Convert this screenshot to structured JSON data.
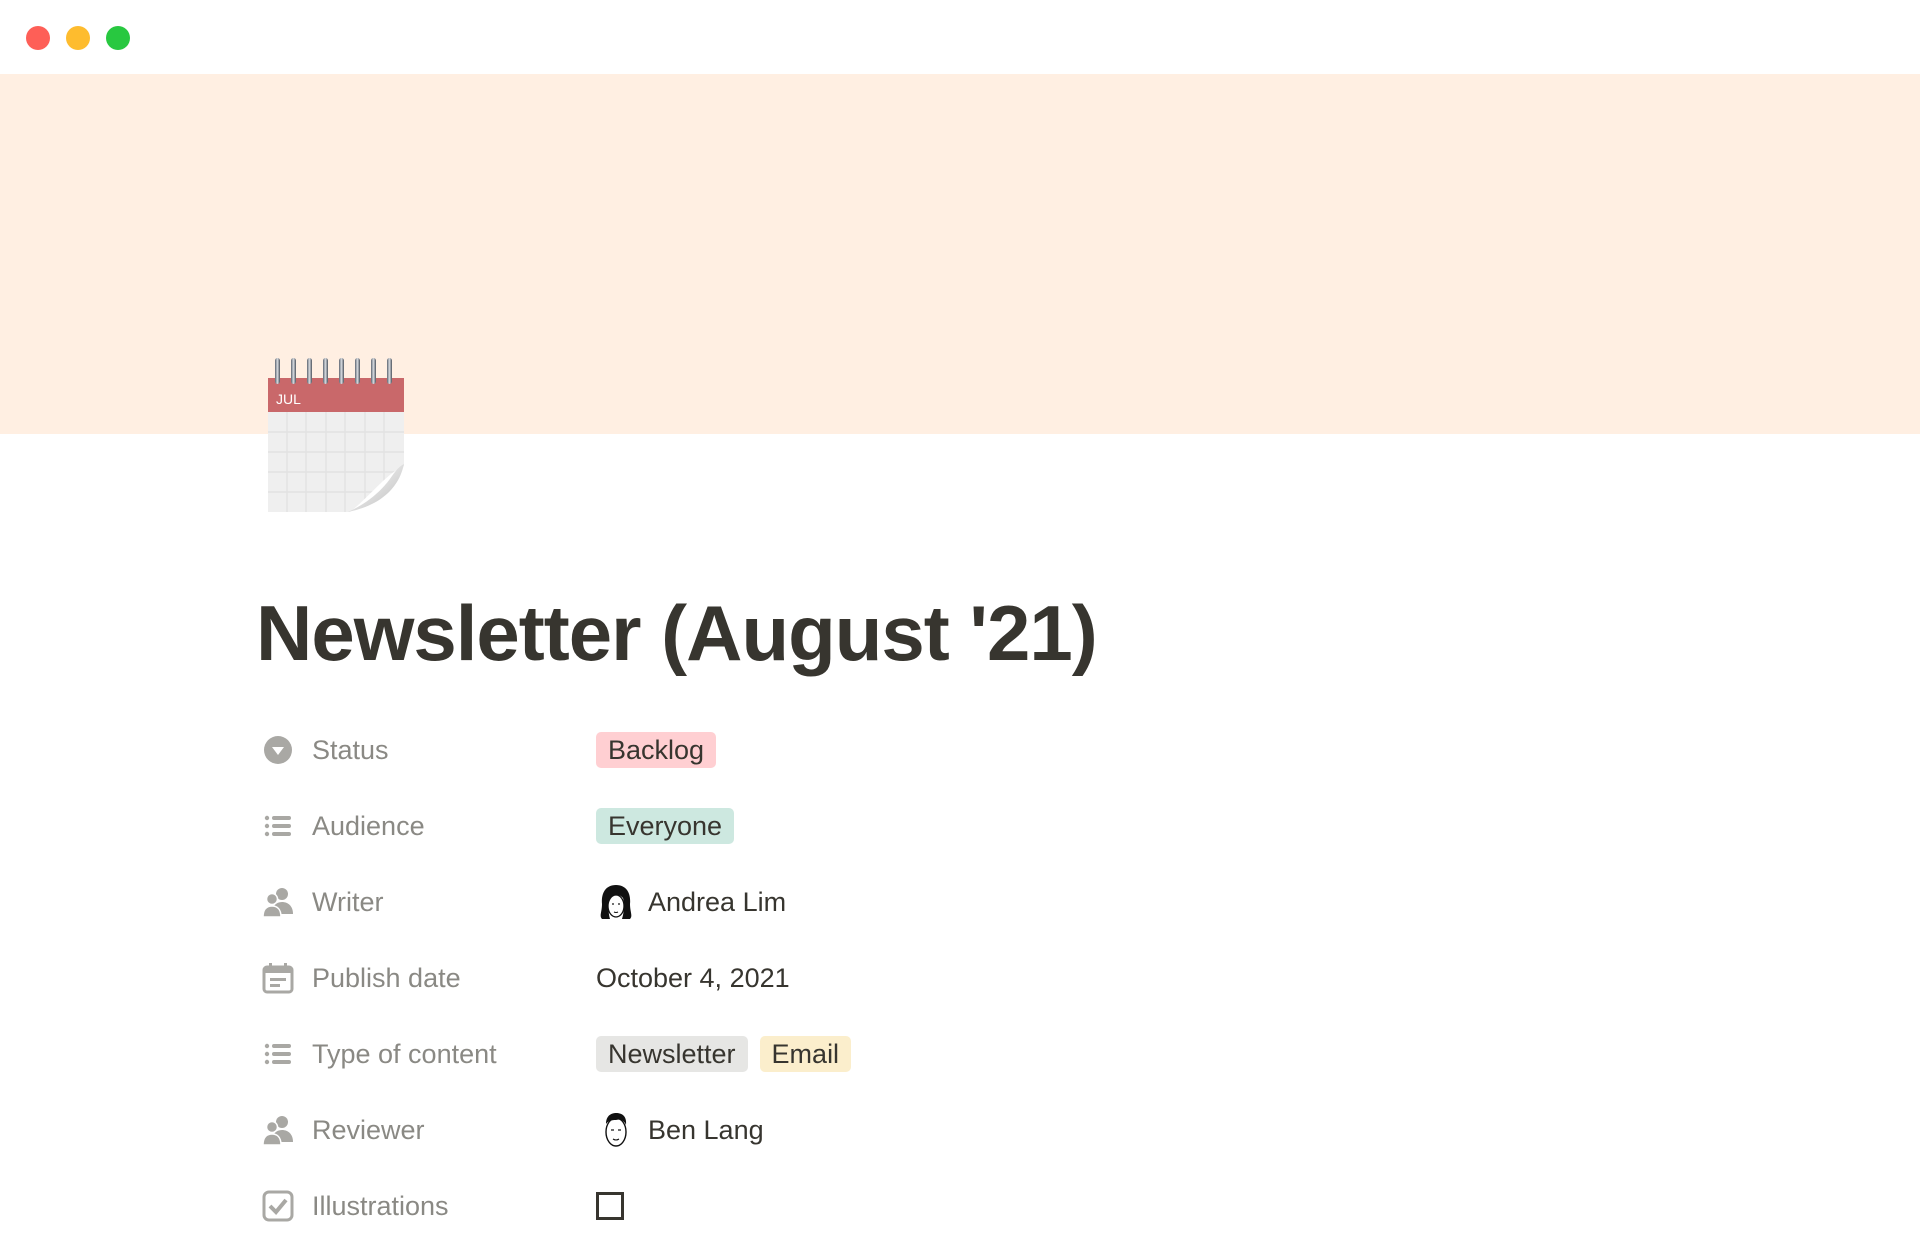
{
  "window": {
    "controls": [
      "close",
      "minimize",
      "maximize"
    ],
    "colors": {
      "close": "#fe5f57",
      "minimize": "#febc2e",
      "maximize": "#28c840"
    }
  },
  "cover": {
    "color": "#ffefe2"
  },
  "page": {
    "icon": "calendar-icon",
    "icon_month": "JUL",
    "title": "Newsletter (August '21)"
  },
  "properties": [
    {
      "label": "Status",
      "icon": "status-select-icon",
      "type": "select",
      "tags": [
        {
          "text": "Backlog",
          "color": "#ffcfd2"
        }
      ]
    },
    {
      "label": "Audience",
      "icon": "list-icon",
      "type": "multi_select",
      "tags": [
        {
          "text": "Everyone",
          "color": "#cde8e0"
        }
      ]
    },
    {
      "label": "Writer",
      "icon": "person-icon",
      "type": "person",
      "person": {
        "name": "Andrea Lim",
        "avatar": "avatar-andrea-lim"
      }
    },
    {
      "label": "Publish date",
      "icon": "calendar-date-icon",
      "type": "date",
      "value": "October 4, 2021"
    },
    {
      "label": "Type of content",
      "icon": "list-icon",
      "type": "multi_select",
      "tags": [
        {
          "text": "Newsletter",
          "color": "#e6e6e4"
        },
        {
          "text": "Email",
          "color": "#fbeecc"
        }
      ]
    },
    {
      "label": "Reviewer",
      "icon": "person-icon",
      "type": "person",
      "person": {
        "name": "Ben Lang",
        "avatar": "avatar-ben-lang"
      }
    },
    {
      "label": "Illustrations",
      "icon": "checkbox-icon",
      "type": "checkbox",
      "checked": false
    }
  ]
}
